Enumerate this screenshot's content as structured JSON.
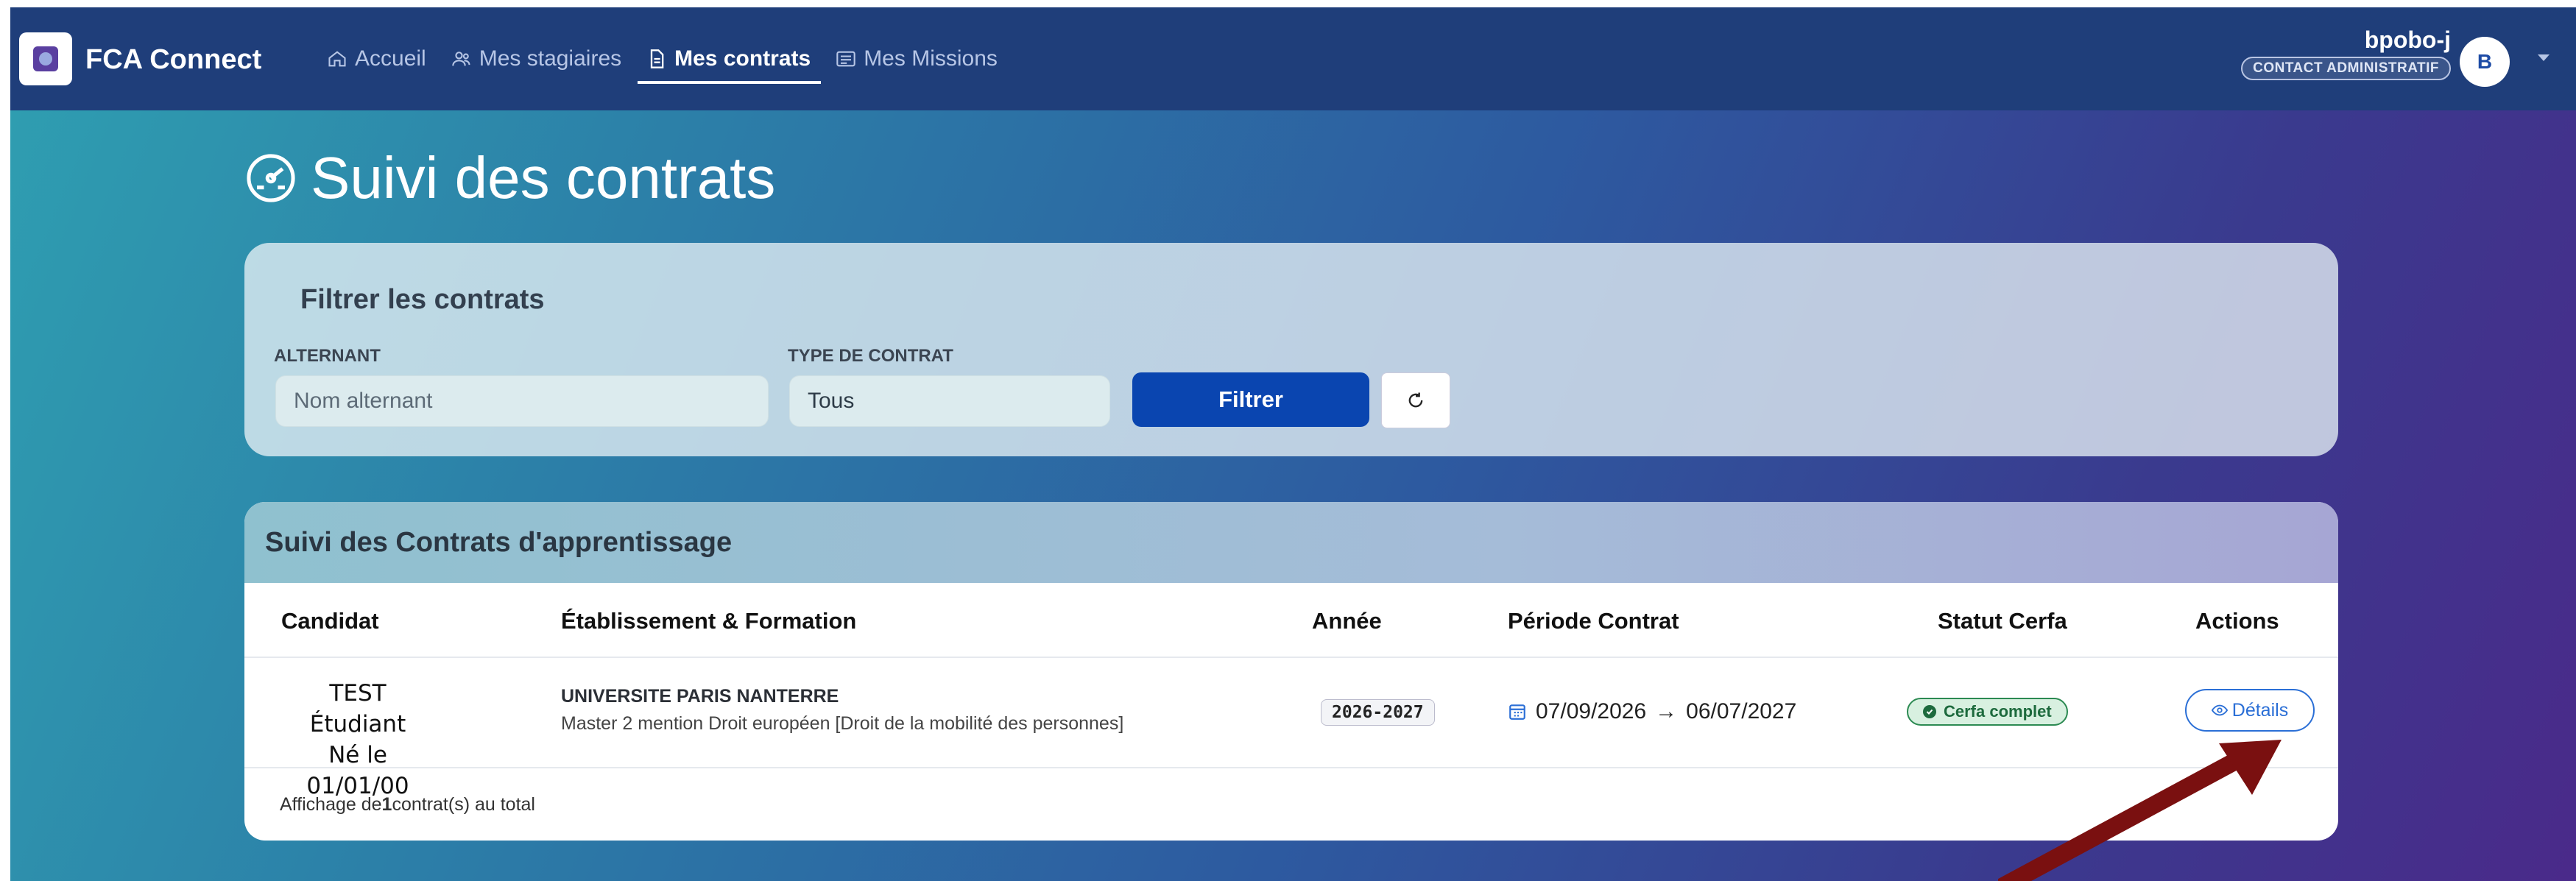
{
  "app": {
    "name": "FCA Connect"
  },
  "nav": {
    "items": [
      {
        "label": "Accueil",
        "icon": "home-icon",
        "active": false
      },
      {
        "label": "Mes stagiaires",
        "icon": "users-icon",
        "active": false
      },
      {
        "label": "Mes contrats",
        "icon": "document-icon",
        "active": true
      },
      {
        "label": "Mes Missions",
        "icon": "id-card-icon",
        "active": false
      }
    ]
  },
  "user": {
    "name": "bpobo-j",
    "role": "CONTACT ADMINISTRATIF",
    "avatar_initial": "B"
  },
  "page": {
    "title": "Suivi des contrats"
  },
  "filter": {
    "title": "Filtrer les contrats",
    "alternant_label": "ALTERNANT",
    "alternant_placeholder": "Nom alternant",
    "type_label": "TYPE DE CONTRAT",
    "type_value": "Tous",
    "submit_label": "Filtrer"
  },
  "table": {
    "title": "Suivi des Contrats d'apprentissage",
    "columns": [
      "Candidat",
      "Établissement & Formation",
      "Année",
      "Période Contrat",
      "Statut Cerfa",
      "Actions"
    ],
    "rows": [
      {
        "candidate_name": "TEST Étudiant",
        "candidate_birth": "Né le 01/01/00",
        "university": "UNIVERSITE PARIS NANTERRE",
        "formation": "Master 2 mention Droit européen [Droit de la mobilité des personnes]",
        "year": "2026-2027",
        "period_start": "07/09/2026",
        "period_arrow": "→",
        "period_end": "06/07/2027",
        "cerfa_status": "Cerfa complet",
        "action_label": "Détails"
      }
    ],
    "footer_prefix": "Affichage de ",
    "footer_count": "1",
    "footer_suffix": " contrat(s) au total"
  },
  "colors": {
    "nav_bg": "#1f3e7a",
    "primary": "#0a45b0",
    "cerfa_green": "#2c8a52",
    "annotation_arrow": "#7a1010"
  }
}
